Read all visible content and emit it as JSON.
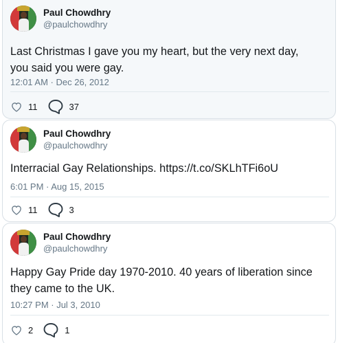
{
  "tweets": [
    {
      "author": {
        "name": "Paul Chowdhry",
        "handle": "@paulchowdhry"
      },
      "text_lines": [
        "Last Christmas I gave you my heart, but the very next day,",
        "you said you were gay."
      ],
      "timestamp": "12:01 AM · Dec 26, 2012",
      "likes": "11",
      "replies": "37"
    },
    {
      "author": {
        "name": "Paul Chowdhry",
        "handle": "@paulchowdhry"
      },
      "text_lines": [
        "Interracial Gay Relationships. https://t.co/SKLhTFi6oU"
      ],
      "timestamp": "6:01 PM · Aug 15, 2015",
      "likes": "11",
      "replies": "3"
    },
    {
      "author": {
        "name": "Paul Chowdhry",
        "handle": "@paulchowdhry"
      },
      "text_lines": [
        "Happy Gay Pride day 1970-2010. 40 years of liberation since",
        "they came to the UK."
      ],
      "timestamp": "10:27 PM · Jul 3, 2010",
      "likes": "2",
      "replies": "1"
    }
  ],
  "icons": {
    "like": "heart-outline-icon",
    "reply": "speech-bubble-icon"
  },
  "colors": {
    "text": "#14171a",
    "muted": "#657786",
    "border": "#d8dfe5",
    "icon": "#657786"
  }
}
